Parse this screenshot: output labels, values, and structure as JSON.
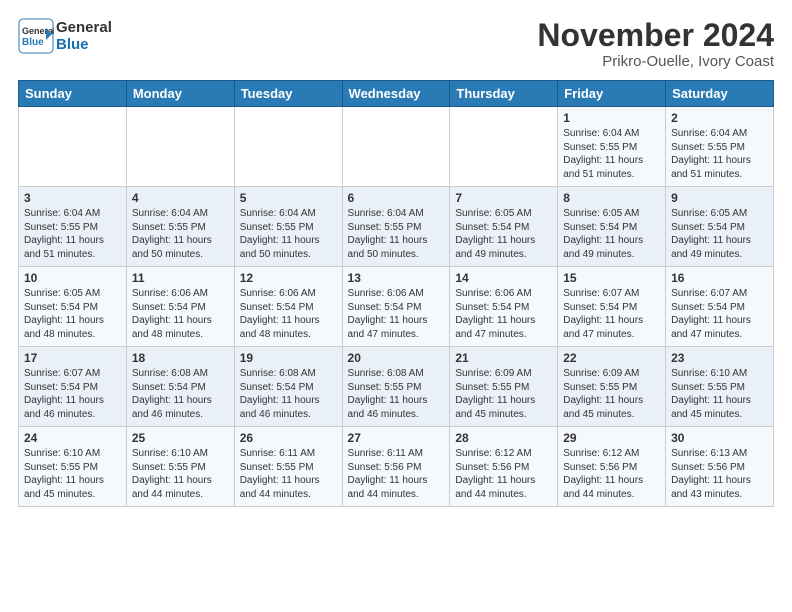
{
  "header": {
    "logo_line1": "General",
    "logo_line2": "Blue",
    "title": "November 2024",
    "subtitle": "Prikro-Ouelle, Ivory Coast"
  },
  "days_of_week": [
    "Sunday",
    "Monday",
    "Tuesday",
    "Wednesday",
    "Thursday",
    "Friday",
    "Saturday"
  ],
  "weeks": [
    [
      {
        "day": "",
        "info": ""
      },
      {
        "day": "",
        "info": ""
      },
      {
        "day": "",
        "info": ""
      },
      {
        "day": "",
        "info": ""
      },
      {
        "day": "",
        "info": ""
      },
      {
        "day": "1",
        "info": "Sunrise: 6:04 AM\nSunset: 5:55 PM\nDaylight: 11 hours and 51 minutes."
      },
      {
        "day": "2",
        "info": "Sunrise: 6:04 AM\nSunset: 5:55 PM\nDaylight: 11 hours and 51 minutes."
      }
    ],
    [
      {
        "day": "3",
        "info": "Sunrise: 6:04 AM\nSunset: 5:55 PM\nDaylight: 11 hours and 51 minutes."
      },
      {
        "day": "4",
        "info": "Sunrise: 6:04 AM\nSunset: 5:55 PM\nDaylight: 11 hours and 50 minutes."
      },
      {
        "day": "5",
        "info": "Sunrise: 6:04 AM\nSunset: 5:55 PM\nDaylight: 11 hours and 50 minutes."
      },
      {
        "day": "6",
        "info": "Sunrise: 6:04 AM\nSunset: 5:55 PM\nDaylight: 11 hours and 50 minutes."
      },
      {
        "day": "7",
        "info": "Sunrise: 6:05 AM\nSunset: 5:54 PM\nDaylight: 11 hours and 49 minutes."
      },
      {
        "day": "8",
        "info": "Sunrise: 6:05 AM\nSunset: 5:54 PM\nDaylight: 11 hours and 49 minutes."
      },
      {
        "day": "9",
        "info": "Sunrise: 6:05 AM\nSunset: 5:54 PM\nDaylight: 11 hours and 49 minutes."
      }
    ],
    [
      {
        "day": "10",
        "info": "Sunrise: 6:05 AM\nSunset: 5:54 PM\nDaylight: 11 hours and 48 minutes."
      },
      {
        "day": "11",
        "info": "Sunrise: 6:06 AM\nSunset: 5:54 PM\nDaylight: 11 hours and 48 minutes."
      },
      {
        "day": "12",
        "info": "Sunrise: 6:06 AM\nSunset: 5:54 PM\nDaylight: 11 hours and 48 minutes."
      },
      {
        "day": "13",
        "info": "Sunrise: 6:06 AM\nSunset: 5:54 PM\nDaylight: 11 hours and 47 minutes."
      },
      {
        "day": "14",
        "info": "Sunrise: 6:06 AM\nSunset: 5:54 PM\nDaylight: 11 hours and 47 minutes."
      },
      {
        "day": "15",
        "info": "Sunrise: 6:07 AM\nSunset: 5:54 PM\nDaylight: 11 hours and 47 minutes."
      },
      {
        "day": "16",
        "info": "Sunrise: 6:07 AM\nSunset: 5:54 PM\nDaylight: 11 hours and 47 minutes."
      }
    ],
    [
      {
        "day": "17",
        "info": "Sunrise: 6:07 AM\nSunset: 5:54 PM\nDaylight: 11 hours and 46 minutes."
      },
      {
        "day": "18",
        "info": "Sunrise: 6:08 AM\nSunset: 5:54 PM\nDaylight: 11 hours and 46 minutes."
      },
      {
        "day": "19",
        "info": "Sunrise: 6:08 AM\nSunset: 5:54 PM\nDaylight: 11 hours and 46 minutes."
      },
      {
        "day": "20",
        "info": "Sunrise: 6:08 AM\nSunset: 5:55 PM\nDaylight: 11 hours and 46 minutes."
      },
      {
        "day": "21",
        "info": "Sunrise: 6:09 AM\nSunset: 5:55 PM\nDaylight: 11 hours and 45 minutes."
      },
      {
        "day": "22",
        "info": "Sunrise: 6:09 AM\nSunset: 5:55 PM\nDaylight: 11 hours and 45 minutes."
      },
      {
        "day": "23",
        "info": "Sunrise: 6:10 AM\nSunset: 5:55 PM\nDaylight: 11 hours and 45 minutes."
      }
    ],
    [
      {
        "day": "24",
        "info": "Sunrise: 6:10 AM\nSunset: 5:55 PM\nDaylight: 11 hours and 45 minutes."
      },
      {
        "day": "25",
        "info": "Sunrise: 6:10 AM\nSunset: 5:55 PM\nDaylight: 11 hours and 44 minutes."
      },
      {
        "day": "26",
        "info": "Sunrise: 6:11 AM\nSunset: 5:55 PM\nDaylight: 11 hours and 44 minutes."
      },
      {
        "day": "27",
        "info": "Sunrise: 6:11 AM\nSunset: 5:56 PM\nDaylight: 11 hours and 44 minutes."
      },
      {
        "day": "28",
        "info": "Sunrise: 6:12 AM\nSunset: 5:56 PM\nDaylight: 11 hours and 44 minutes."
      },
      {
        "day": "29",
        "info": "Sunrise: 6:12 AM\nSunset: 5:56 PM\nDaylight: 11 hours and 44 minutes."
      },
      {
        "day": "30",
        "info": "Sunrise: 6:13 AM\nSunset: 5:56 PM\nDaylight: 11 hours and 43 minutes."
      }
    ]
  ]
}
